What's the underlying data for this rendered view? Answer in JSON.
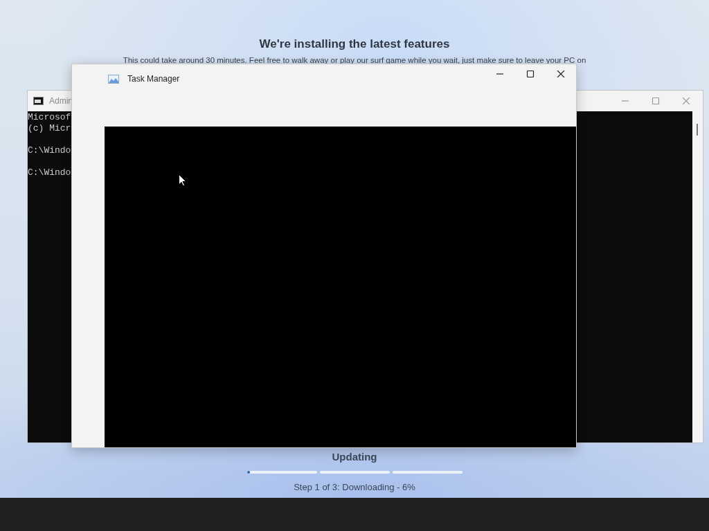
{
  "setup": {
    "title": "We're installing the latest features",
    "subtitle": "This could take around 30 minutes. Feel free to walk away or play our surf game while you wait, just make sure to leave your PC on",
    "status": "Updating",
    "progress": [
      {
        "level": 0.02
      },
      {
        "level": 0
      },
      {
        "level": 0
      }
    ],
    "step": "Step 1 of 3: Downloading - 6%"
  },
  "console_window": {
    "title": "Admin",
    "output": "Microsof\n(c) Micr\n\nC:\\Windo\n\nC:\\Windo"
  },
  "task_manager": {
    "title": "Task Manager"
  }
}
